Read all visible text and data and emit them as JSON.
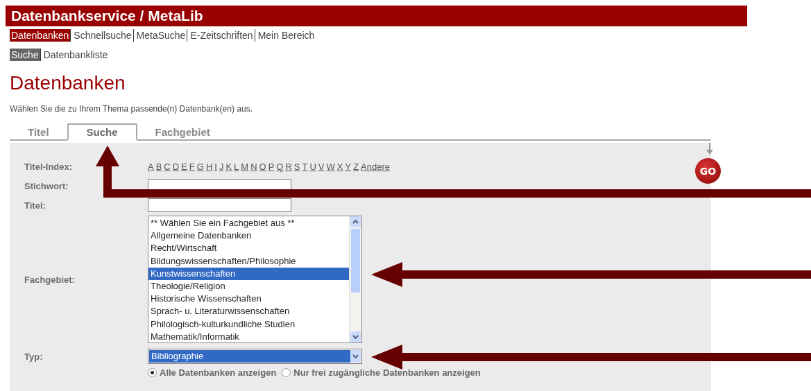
{
  "header": {
    "title": "Datenbankservice / MetaLib"
  },
  "nav": [
    {
      "label": "Datenbanken",
      "selected": true
    },
    {
      "label": "Schnellsuche",
      "selected": false
    },
    {
      "label": "MetaSuche",
      "selected": false
    },
    {
      "label": "E-Zeitschriften",
      "selected": false
    },
    {
      "label": "Mein Bereich",
      "selected": false
    }
  ],
  "subnav": [
    {
      "label": "Suche",
      "selected": true
    },
    {
      "label": "Datenbankliste",
      "selected": false
    }
  ],
  "heading": "Datenbanken",
  "instruction": "Wählen Sie die zu Ihrem Thema passende(n) Datenbank(en) aus.",
  "tabs": [
    {
      "label": "Titel",
      "selected": false
    },
    {
      "label": "Suche",
      "selected": true
    },
    {
      "label": "Fachgebiet",
      "selected": false
    }
  ],
  "form": {
    "index_label": "Titel-Index:",
    "letters": [
      "A",
      "B",
      "C",
      "D",
      "E",
      "F",
      "G",
      "H",
      "I",
      "J",
      "K",
      "L",
      "M",
      "N",
      "O",
      "P",
      "Q",
      "R",
      "S",
      "T",
      "U",
      "V",
      "W",
      "X",
      "Y",
      "Z",
      "Andere"
    ],
    "keyword_label": "Stichwort:",
    "title_label": "Titel:",
    "subject_label": "Fachgebiet:",
    "subjects": [
      {
        "label": "** Wählen Sie ein Fachgebiet aus **",
        "selected": false
      },
      {
        "label": "Allgemeine Datenbanken",
        "selected": false
      },
      {
        "label": "Recht/Wirtschaft",
        "selected": false
      },
      {
        "label": "Bildungswissenschaften/Philosophie",
        "selected": false
      },
      {
        "label": "Kunstwissenschaften",
        "selected": true
      },
      {
        "label": "Theologie/Religion",
        "selected": false
      },
      {
        "label": "Historische Wissenschaften",
        "selected": false
      },
      {
        "label": "Sprach- u. Literaturwissenschaften",
        "selected": false
      },
      {
        "label": "Philologisch-kulturkundliche Studien",
        "selected": false
      },
      {
        "label": "Mathematik/Informatik",
        "selected": false
      }
    ],
    "type_label": "Typ:",
    "type_value": "Bibliographie",
    "radios": [
      {
        "label": "Alle Datenbanken anzeigen",
        "selected": true
      },
      {
        "label": "Nur frei zugängliche Datenbanken anzeigen",
        "selected": false
      }
    ],
    "go_button": "GO"
  }
}
